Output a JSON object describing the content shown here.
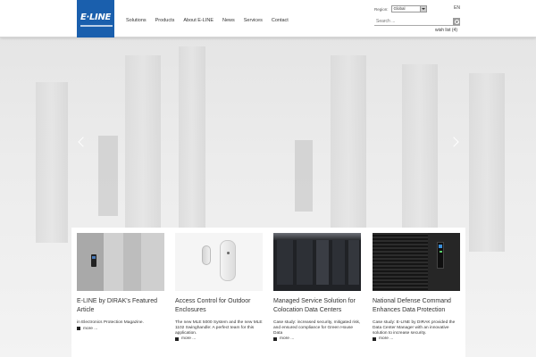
{
  "header": {
    "logo_text": "E·LINE",
    "nav": [
      "Solutions",
      "Products",
      "About E-LINE",
      "News",
      "Services",
      "Contact"
    ],
    "region_label": "Region:",
    "region_value": "Global",
    "lang": "EN",
    "search_placeholder": "Search ...",
    "wishlist": "wish list (4)"
  },
  "cards": [
    {
      "title": "E-LINE by DIRAK's Featured Article",
      "text": "in Electronics Protection Magazine.",
      "more": "more ..."
    },
    {
      "title": "Access Control for Outdoor Enclosures",
      "text": "The new MLE 5000 System and the new MLE 1102 Swinghandle: A perfect team for this application.",
      "more": "more ..."
    },
    {
      "title": "Managed Service Solution for Colocation Data Centers",
      "text": "Case study: increased security, mitigated risk, and ensured compliance for Green House Data",
      "more": "more ..."
    },
    {
      "title": "National Defense Command Enhances Data Protection",
      "text": "Case study: E-LINE by DIRAK provided the Data Center Manager with an innovative solution to increase security.",
      "more": "more ..."
    }
  ],
  "colors": {
    "brand": "#1a5fad",
    "hero_bg": "#e9e9e9"
  },
  "icons": [
    "search-icon",
    "chevron-left-icon",
    "chevron-right-icon",
    "dropdown-arrow-icon"
  ]
}
